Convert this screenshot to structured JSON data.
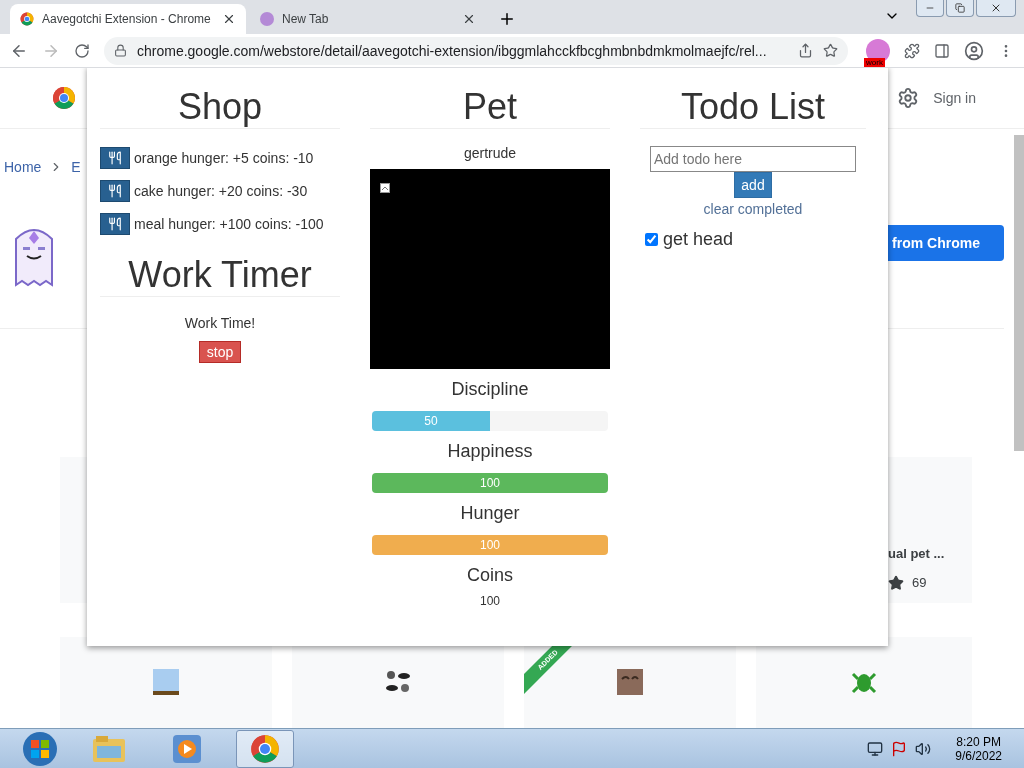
{
  "browser": {
    "tabs": [
      {
        "title": "Aavegotchi Extension - Chrome",
        "selected": true
      },
      {
        "title": "New Tab",
        "selected": false
      }
    ],
    "url": "chrome.google.com/webstore/detail/aavegotchi-extension/ibggmlahcckfbcghmbnbdmkmolmaejfc/rel...",
    "extension_badge": "work"
  },
  "store_page": {
    "sign_in": "Sign in",
    "breadcrumb": [
      "Home",
      "E"
    ],
    "install_button": "from Chrome",
    "card_title": "ual pet ...",
    "rating_count": "69",
    "ribbon": "ADDED"
  },
  "popup": {
    "shop": {
      "title": "Shop",
      "items": [
        {
          "label": "orange hunger: +5 coins: -10"
        },
        {
          "label": "cake hunger: +20 coins: -30"
        },
        {
          "label": "meal hunger: +100 coins: -100"
        }
      ]
    },
    "timer": {
      "title": "Work Timer",
      "status": "Work Time!",
      "button": "stop"
    },
    "pet": {
      "title": "Pet",
      "name": "gertrude",
      "stats": [
        {
          "label": "Discipline",
          "level": 0.5,
          "reading": "50",
          "color": "#5bc0de"
        },
        {
          "label": "Happiness",
          "level": 1,
          "reading": "100",
          "color": "#5cb85c"
        },
        {
          "label": "Hunger",
          "level": 1,
          "reading": "100",
          "color": "#f0ad4e"
        }
      ],
      "coins": {
        "label": "Coins",
        "value": "100"
      }
    },
    "todo": {
      "title": "Todo List",
      "placeholder": "Add todo here",
      "add_button": "add",
      "clear_link": "clear completed",
      "items": [
        {
          "text": "get head",
          "checked": true
        }
      ]
    }
  },
  "taskbar": {
    "time": "8:20 PM",
    "date": "9/6/2022"
  }
}
